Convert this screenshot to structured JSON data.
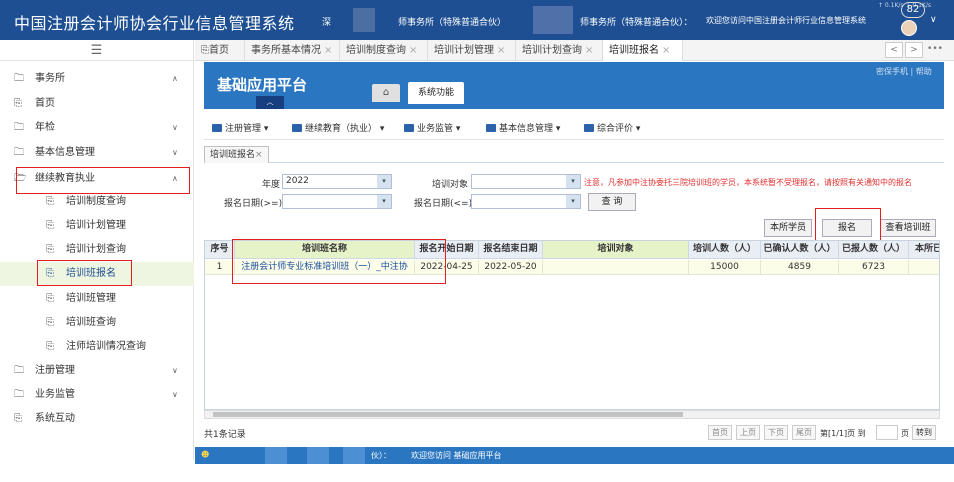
{
  "header": {
    "title": "中国注册会计师协会行业信息管理系统",
    "seg1": "深",
    "seg2": "师事务所（特殊普通合伙）",
    "seg3": "师事务所（特殊普通合伙）：",
    "welcome": "欢迎您访问中国注册会计师行业信息管理系统",
    "badge": "82",
    "net_rate": "↑ 0.1K/s ↓ 0.1K/s",
    "caret": "∨"
  },
  "sidebar": {
    "menu_icon": "☰",
    "items": [
      {
        "label": "事务所",
        "chev": "∧"
      },
      {
        "label": "首页"
      },
      {
        "label": "年检",
        "chev": "∨"
      },
      {
        "label": "基本信息管理",
        "chev": "∨"
      },
      {
        "label": "继续教育执业",
        "chev": "∧"
      },
      {
        "label": "培训制度查询"
      },
      {
        "label": "培训计划管理"
      },
      {
        "label": "培训计划查询"
      },
      {
        "label": "培训班报名"
      },
      {
        "label": "培训班管理"
      },
      {
        "label": "培训班查询"
      },
      {
        "label": "注师培训情况查询"
      },
      {
        "label": "注册管理",
        "chev": "∨"
      },
      {
        "label": "业务监管",
        "chev": "∨"
      },
      {
        "label": "系统互动"
      }
    ]
  },
  "tabs": [
    {
      "label": "首页"
    },
    {
      "label": "事务所基本情况"
    },
    {
      "label": "培训制度查询"
    },
    {
      "label": "培训计划管理"
    },
    {
      "label": "培训计划查询"
    },
    {
      "label": "培训班报名"
    }
  ],
  "tab_close": "×",
  "tab_nav": {
    "prev": "<",
    "next": ">",
    "more": "•••"
  },
  "app": {
    "platform": "基础应用平台",
    "arrow": "︿",
    "home": "⌂",
    "sys_tab": "系统功能",
    "links": "密保手机 | 帮助"
  },
  "toolbar": [
    {
      "label": "注册管理"
    },
    {
      "label": "继续教育（执业）"
    },
    {
      "label": "业务监管"
    },
    {
      "label": "基本信息管理"
    },
    {
      "label": "综合评价"
    }
  ],
  "dd_arrow": "▾",
  "subtab": {
    "label": "培训班报名",
    "close": "×"
  },
  "filters": {
    "year_label": "年度",
    "year_value": "2022",
    "target_label": "培训对象",
    "start_label": "报名日期(>=)",
    "end_label": "报名日期(<=)",
    "search_btn": "查 询",
    "notice": "注意，凡参加中注协委托三院培训班的学员，本系统暂不受理报名，请按照有关通知中的报名"
  },
  "actions": {
    "staff": "本所学员",
    "register": "报名",
    "view": "查看培训班"
  },
  "table": {
    "headers": [
      "序号",
      "培训班名称",
      "报名开始日期",
      "报名结束日期",
      "培训对象",
      "培训人数（人）",
      "已确认人数（人）",
      "已报人数（人）",
      "本所已"
    ],
    "rows": [
      {
        "no": "1",
        "name": "注册会计师专业标准培训班（一）_中注协",
        "start": "2022-04-25",
        "end": "2022-05-20",
        "target": "",
        "count": "15000",
        "confirmed": "4859",
        "reported": "6723",
        "own": ""
      }
    ]
  },
  "pager": {
    "summary": "共1条记录",
    "first": "首页",
    "prev": "上页",
    "next": "下页",
    "last": "尾页",
    "page_info": "第[1/1]页 到",
    "page_suffix": "页",
    "go": "转到"
  },
  "footer": {
    "text1": "伙）：",
    "text2": "欢迎您访问 基础应用平台"
  }
}
